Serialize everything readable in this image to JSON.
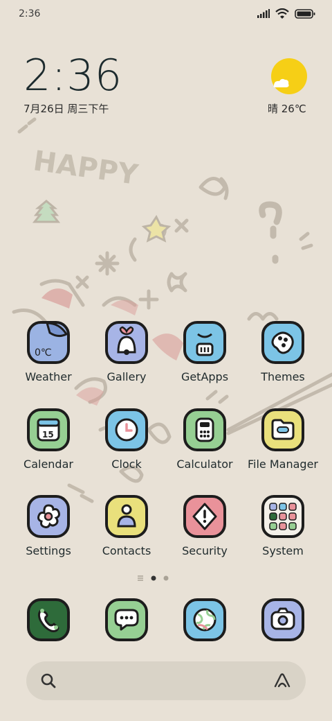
{
  "status_bar": {
    "time": "2:36"
  },
  "widget": {
    "time": "2:36",
    "date": "7月26日 周三下午",
    "weather": "晴 26℃"
  },
  "apps": [
    {
      "label": "Weather",
      "icon": "weather-app-icon",
      "color": "#9bb3e3"
    },
    {
      "label": "Gallery",
      "icon": "gallery-app-icon",
      "color": "#a7b4e6"
    },
    {
      "label": "GetApps",
      "icon": "getapps-app-icon",
      "color": "#7cc4e6"
    },
    {
      "label": "Themes",
      "icon": "themes-app-icon",
      "color": "#7cc4e6"
    },
    {
      "label": "Calendar",
      "icon": "calendar-app-icon",
      "color": "#96cf93"
    },
    {
      "label": "Clock",
      "icon": "clock-app-icon",
      "color": "#7cc4e6"
    },
    {
      "label": "Calculator",
      "icon": "calculator-app-icon",
      "color": "#96cf93"
    },
    {
      "label": "File Manager",
      "icon": "file-manager-app-icon",
      "color": "#e9e07c"
    },
    {
      "label": "Settings",
      "icon": "settings-app-icon",
      "color": "#a7b4e6"
    },
    {
      "label": "Contacts",
      "icon": "contacts-app-icon",
      "color": "#e9e07c"
    },
    {
      "label": "Security",
      "icon": "security-app-icon",
      "color": "#e9929a"
    },
    {
      "label": "System",
      "icon": "system-folder-icon",
      "color": "#f4f1ea"
    }
  ],
  "weather_icon_text": "0℃",
  "dock": [
    {
      "icon": "phone-app-icon",
      "color": "#2e6b3a"
    },
    {
      "icon": "messages-app-icon",
      "color": "#96cf93"
    },
    {
      "icon": "browser-app-icon",
      "color": "#7cc4e6"
    },
    {
      "icon": "camera-app-icon",
      "color": "#a7b4e6"
    }
  ],
  "wallpaper_text": "HAPPY"
}
